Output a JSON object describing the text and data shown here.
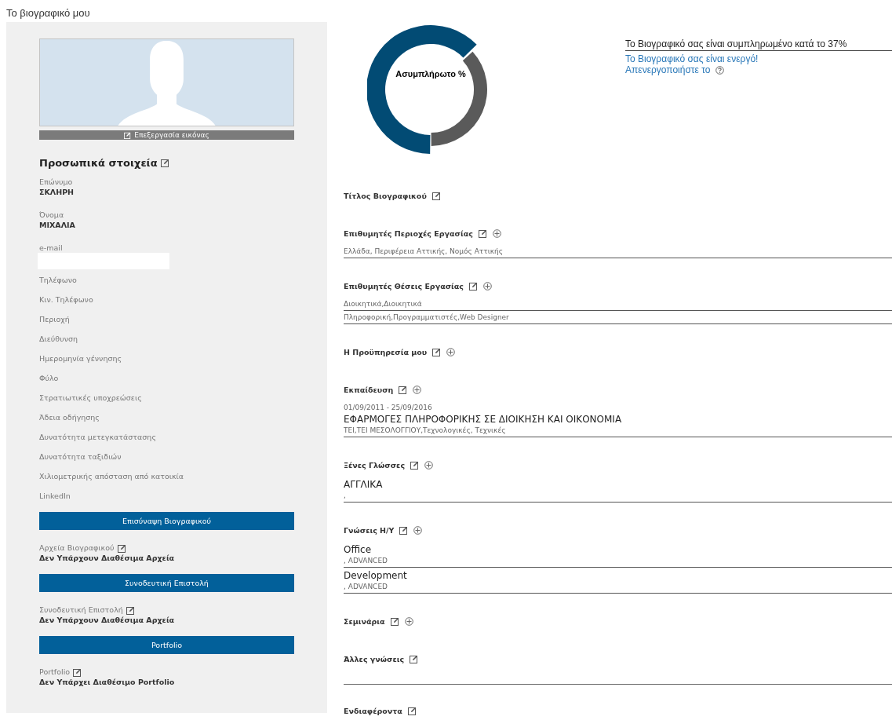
{
  "page_title": "Το βιογραφικό μου",
  "profile": {
    "photo_action": "Επεξεργασία εικόνας",
    "section_title": "Προσωπικά στοιχεία",
    "fields": [
      {
        "label": "Επώνυμο",
        "value": "ΣΚΛΗΡΗ"
      },
      {
        "label": "Όνομα",
        "value": "ΜΙΧΑΛΙΑ"
      },
      {
        "label": "e-mail",
        "redacted": true
      },
      {
        "label": "Τηλέφωνο"
      },
      {
        "label": "Κιν. Τηλέφωνο"
      },
      {
        "label": "Περιοχή"
      },
      {
        "label": "Διεύθυνση"
      },
      {
        "label": "Ημερομηνία γέννησης"
      },
      {
        "label": "Φύλο"
      },
      {
        "label": "Στρατιωτικές υποχρεώσεις"
      },
      {
        "label": "Άδεια οδήγησης"
      },
      {
        "label": "Δυνατότητα μετεγκατάστασης"
      },
      {
        "label": "Δυνατότητα ταξιδιών"
      },
      {
        "label": "Χιλιομετρικής απόσταση από κατοικία"
      },
      {
        "label": "LinkedIn"
      }
    ]
  },
  "attachments": [
    {
      "button": "Επισύναψη Βιογραφικού",
      "label": "Αρχεία Βιογραφικού",
      "value": "Δεν Υπάρχουν Διαθέσιμα Αρχεία"
    },
    {
      "button": "Συνοδευτική Επιστολή",
      "label": "Συνοδευτική Επιστολή",
      "value": "Δεν Υπάρχουν Διαθέσιμα Αρχεία"
    },
    {
      "button": "Portfolio",
      "label": "Portfolio",
      "value": "Δεν Υπάρχει Διαθέσιμο Portfolio"
    }
  ],
  "completion": {
    "chart_label": "Ασυμπλήρωτο %",
    "status": "Το Βιογραφικό σας είναι συμπληρωμένο κατά το 37%",
    "active_text": "Το Βιογραφικό σας είναι ενεργό!",
    "deactivate_link": "Απενεργοποιήστε το"
  },
  "sections": [
    {
      "title": "Τίτλος Βιογραφικού",
      "addable": false,
      "rule": false
    },
    {
      "title": "Επιθυμητές Περιοχές Εργασίας",
      "addable": true,
      "rule": false,
      "items": [
        {
          "lines": [
            {
              "kind": "detail",
              "text": "Ελλάδα, Περιφέρεια Αττικής, Νομός Αττικής"
            }
          ]
        }
      ]
    },
    {
      "title": "Επιθυμητές Θέσεις Εργασίας",
      "addable": true,
      "rule": false,
      "items": [
        {
          "lines": [
            {
              "kind": "detail",
              "text": "Διοικητικά,Διοικητικά"
            }
          ]
        },
        {
          "lines": [
            {
              "kind": "detail",
              "text": "Πληροφορική,Προγραμματιστές,Web Designer"
            }
          ]
        }
      ]
    },
    {
      "title": "Η Προϋπηρεσία μου",
      "addable": true,
      "rule": false
    },
    {
      "title": "Εκπαίδευση",
      "addable": true,
      "rule": false,
      "items": [
        {
          "lines": [
            {
              "kind": "detail",
              "text": "01/09/2011 - 25/09/2016"
            },
            {
              "kind": "title",
              "text": "ΕΦΑΡΜΟΓΕΣ ΠΛΗΡΟΦΟΡΙΚΗΣ ΣΕ ΔΙΟΙΚΗΣΗ ΚΑΙ ΟΙΚΟΝΟΜΙΑ"
            },
            {
              "kind": "detail",
              "text": "ΤΕΙ,ΤΕΙ ΜΕΣΟΛΟΓΓΙΟΥ,Τεχνολογικές, Τεχνικές"
            }
          ]
        }
      ]
    },
    {
      "title": "Ξένες Γλώσσες",
      "addable": true,
      "rule": false,
      "items": [
        {
          "lines": [
            {
              "kind": "title",
              "text": "ΑΓΓΛΙΚΑ"
            },
            {
              "kind": "detail",
              "text": ","
            }
          ]
        }
      ]
    },
    {
      "title": "Γνώσεις Η/Υ",
      "addable": true,
      "rule": false,
      "items": [
        {
          "lines": [
            {
              "kind": "title",
              "text": "Office"
            },
            {
              "kind": "detail",
              "text": ", ADVANCED"
            }
          ]
        },
        {
          "lines": [
            {
              "kind": "title",
              "text": "Development"
            },
            {
              "kind": "detail",
              "text": ", ADVANCED"
            }
          ]
        }
      ]
    },
    {
      "title": "Σεμινάρια",
      "addable": true,
      "rule": false
    },
    {
      "title": "Άλλες γνώσεις",
      "addable": false,
      "rule": true
    },
    {
      "title": "Ενδιαφέροντα",
      "addable": false,
      "rule": false
    }
  ]
}
